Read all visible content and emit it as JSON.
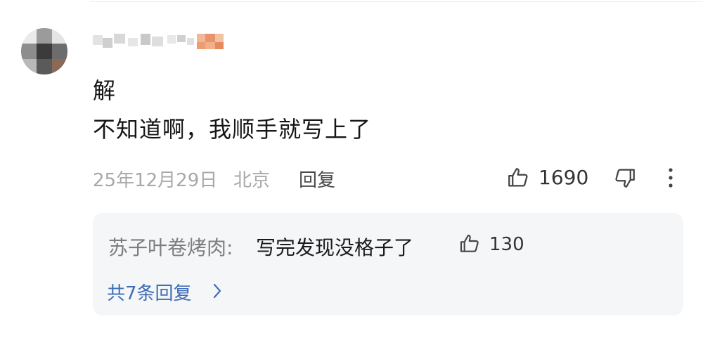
{
  "comment": {
    "lines": [
      "解",
      "不知道啊，我顺手就写上了"
    ],
    "date": "25年12月29日",
    "location": "北京",
    "reply_label": "回复",
    "like_count": "1690"
  },
  "reply_preview": {
    "author": "苏子叶卷烤肉:",
    "text": "写完发现没格子了",
    "like_count": "130",
    "view_all_label": "共7条回复"
  },
  "icons": {
    "like": "thumbs-up-icon",
    "dislike": "thumbs-down-icon",
    "more": "more-vertical-icon",
    "chevron": "chevron-right-icon"
  },
  "colors": {
    "link_blue": "#3f6eb5",
    "meta_gray": "#a8a8a8",
    "reply_bg": "#f5f6f8"
  }
}
